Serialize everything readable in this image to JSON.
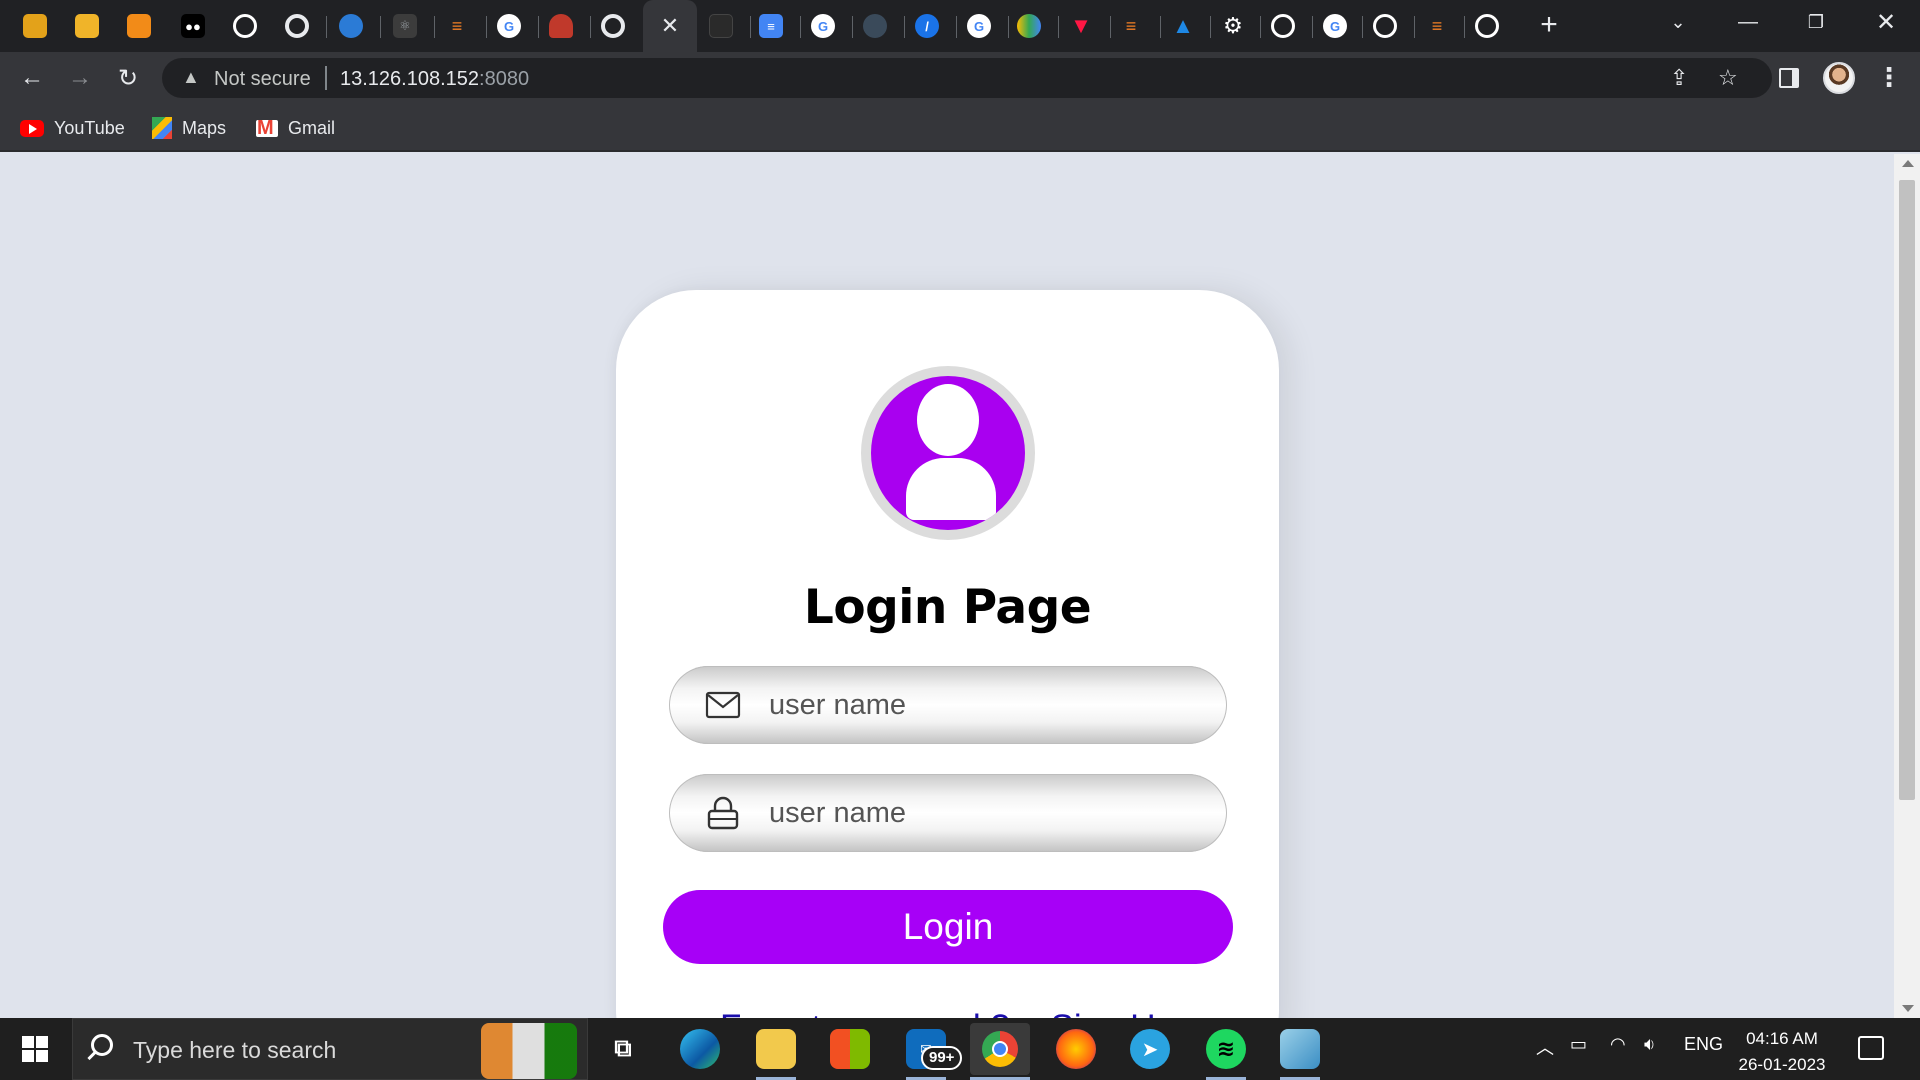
{
  "browser": {
    "address": {
      "security_label": "Not secure",
      "host": "13.126.108.152",
      "port": ":8080"
    },
    "active_tab_close": "✕",
    "new_tab": "+",
    "bookmarks": [
      {
        "label": "YouTube",
        "icon": "youtube-icon"
      },
      {
        "label": "Maps",
        "icon": "maps-icon"
      },
      {
        "label": "Gmail",
        "icon": "gmail-icon"
      }
    ],
    "tab_favicons": [
      "package",
      "package",
      "box",
      "medium",
      "github",
      "chrome",
      "edge",
      "react",
      "stackoverflow",
      "google",
      "figure",
      "chrome",
      "active",
      "terminal",
      "docs",
      "google",
      "docker",
      "safari",
      "google",
      "drive",
      "vercel",
      "stackoverflow",
      "azure",
      "gear",
      "github",
      "google",
      "github",
      "stackoverflow",
      "github"
    ]
  },
  "page": {
    "title": "Login Page",
    "username_placeholder": "user name",
    "password_placeholder": "user name",
    "login_label": "Login",
    "forgot_link": "Forgot password ?",
    "separator": "○",
    "signup_link": "Sign Up",
    "avatar_color": "#a900f0",
    "button_color": "#a700f7"
  },
  "taskbar": {
    "search_placeholder": "Type here to search",
    "mail_badge": "99+",
    "language": "ENG",
    "time": "04:16 AM",
    "date": "26-01-2023"
  }
}
